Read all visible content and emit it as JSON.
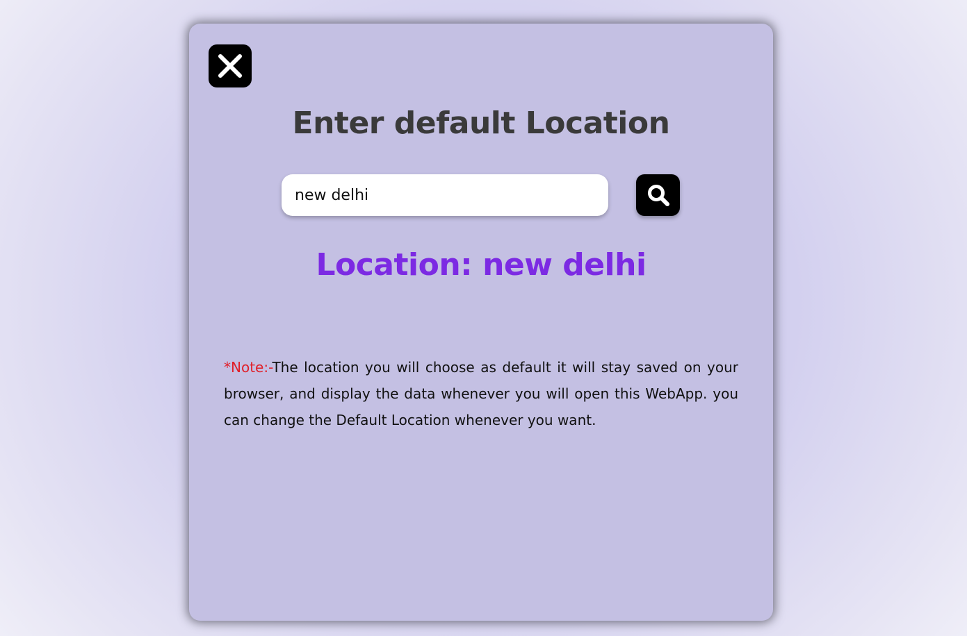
{
  "modal": {
    "title": "Enter default Location",
    "search": {
      "value": "new delhi",
      "placeholder": ""
    },
    "location_label": "Location: new delhi",
    "note": {
      "prefix": "*Note:-",
      "text": "The location you will choose as default it will stay saved on your browser, and display the data whenever you will open this WebApp. you can change the Default Location whenever you want."
    },
    "icons": {
      "close": "close-icon",
      "search": "search-icon"
    }
  },
  "colors": {
    "modal_background": "#c4c0e3",
    "title": "#3a3a3a",
    "location_text": "#7c2ae3",
    "note_prefix": "#e0202a",
    "button_background": "#000000"
  }
}
